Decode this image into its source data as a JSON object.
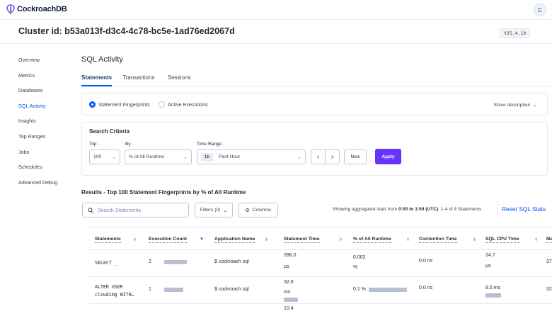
{
  "app": {
    "name": "CockroachDB",
    "user_initial": "C"
  },
  "cluster": {
    "title": "Cluster id: b53a013f-d3c4-4c78-bc5e-1ad76ed2067d",
    "version": "V25.4.10"
  },
  "sidebar": {
    "items": [
      {
        "label": "Overview",
        "active": false
      },
      {
        "label": "Metrics",
        "active": false
      },
      {
        "label": "Databases",
        "active": false
      },
      {
        "label": "SQL Activity",
        "active": true
      },
      {
        "label": "Insights",
        "active": false
      },
      {
        "label": "Top Ranges",
        "active": false
      },
      {
        "label": "Jobs",
        "active": false
      },
      {
        "label": "Schedules",
        "active": false
      },
      {
        "label": "Advanced Debug",
        "active": false
      }
    ]
  },
  "page": {
    "title": "SQL Activity",
    "tabs": [
      {
        "label": "Statements",
        "active": true
      },
      {
        "label": "Transactions",
        "active": false
      },
      {
        "label": "Sessions",
        "active": false
      }
    ],
    "radio": {
      "fingerprints": "Statement Fingerprints",
      "active": "Active Executions"
    },
    "show_description": "Show description"
  },
  "criteria": {
    "title": "Search Criteria",
    "top_label": "Top",
    "top_value": "100",
    "by_label": "By",
    "by_value": "% of All Runtime",
    "range_label": "Time Range",
    "range_chip": "1h",
    "range_value": "Past Hour",
    "now_label": "Now",
    "apply_label": "Apply"
  },
  "results": {
    "title": "Results - Top 100 Statement Fingerprints by % of All Runtime",
    "search_placeholder": "Search Statements",
    "filters_label": "Filters (0)",
    "columns_label": "Columns",
    "stats_prefix": "Showing aggregated stats from ",
    "stats_range": "0:00 to 1:59 (UTC)",
    "stats_suffix": ", 1-4 of 4 Statements",
    "reset_label": "Reset SQL Stats"
  },
  "table": {
    "headers": [
      "Statements",
      "Execution Count",
      "Application Name",
      "Statement Time",
      "% of All Runtime",
      "Contention Time",
      "SQL CPU Time",
      "Ma"
    ],
    "rows": [
      {
        "statement_l1": "SELECT _",
        "statement_l2": "",
        "count": "2",
        "count_bar": 0.9,
        "app": "$ cockroach sql",
        "time_l1": "288.0",
        "time_l2": "µs",
        "time_bar": 0.0,
        "pct_l1": "0.002",
        "pct_l2": "%",
        "pct_bar": 0.01,
        "contention": "0.0 ns",
        "cpu_l1": "24.7",
        "cpu_l2": "µs",
        "cpu_bar": 0.01,
        "max": "37"
      },
      {
        "statement_l1": "ALTER USER",
        "statement_l2": "cloudimg WITH…",
        "count": "1",
        "count_bar": 0.75,
        "app": "$ cockroach sql",
        "time_l1": "32.6",
        "time_l2": "ms",
        "time_bar": 1.0,
        "pct_l1": "0.1 %",
        "pct_l2": "",
        "pct_bar": 1.0,
        "contention": "0.0 ns",
        "cpu_l1": "8.5 ms",
        "cpu_l2": "",
        "cpu_bar": 1.0,
        "max": "32"
      },
      {
        "statement_l1": "",
        "statement_l2": "",
        "count": "",
        "count_bar": 0,
        "app": "",
        "time_l1": "10.4",
        "time_l2": "",
        "time_bar": 0,
        "pct_l1": "",
        "pct_l2": "",
        "pct_bar": 0,
        "contention": "",
        "cpu_l1": "",
        "cpu_l2": "",
        "cpu_bar": 0,
        "max": ""
      }
    ]
  }
}
